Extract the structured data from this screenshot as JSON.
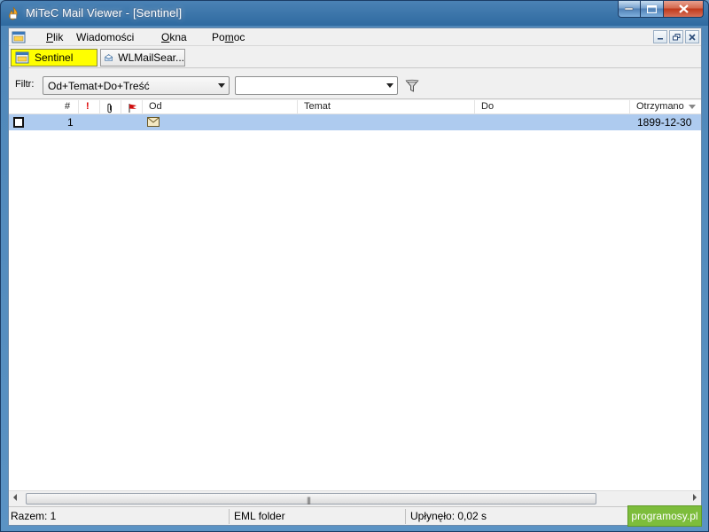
{
  "window": {
    "title": "MiTeC Mail Viewer - [Sentinel]"
  },
  "menu": {
    "items": [
      {
        "label": "Plik",
        "underline": "P",
        "rest": "lik"
      },
      {
        "label": "Wiadomości"
      },
      {
        "label": "Okna",
        "underline": "O",
        "rest": "kna"
      },
      {
        "label": "Pomoc",
        "pre": "Po",
        "underline": "m",
        "rest": "oc"
      }
    ]
  },
  "tabs": [
    {
      "label": "Sentinel",
      "active": true
    },
    {
      "label": "WLMailSear...",
      "active": false
    }
  ],
  "filter": {
    "label": "Filtr:",
    "selected": "Od+Temat+Do+Treść",
    "search_value": ""
  },
  "grid": {
    "columns": [
      "#",
      "!",
      "@",
      "flag",
      "Od",
      "Temat",
      "Do",
      "Otrzymano"
    ],
    "rows": [
      {
        "num": "1",
        "od": "",
        "temat": "",
        "do": "",
        "otrzymano": "1899-12-30"
      }
    ]
  },
  "status": {
    "count": "Razem: 1",
    "type": "EML folder",
    "elapsed": "Upłynęło: 0,02 s"
  },
  "watermark": "programosy.pl",
  "colors": {
    "selected_row": "#aecbef",
    "active_tab": "#ffff00",
    "watermark_bg": "#7dbd3c"
  }
}
